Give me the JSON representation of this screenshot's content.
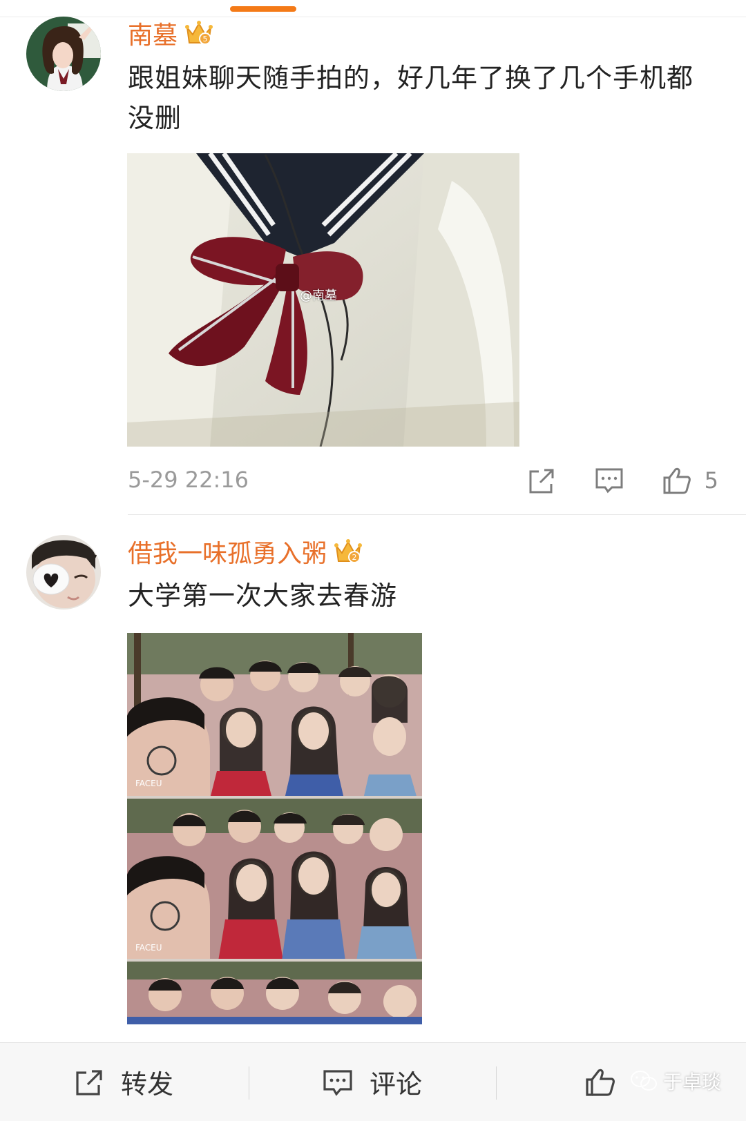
{
  "comments": [
    {
      "username": "南墓",
      "text": "跟姐妹聊天随手拍的，好几年了换了几个手机都没删",
      "photo_watermark": "@南墓",
      "timestamp": "5-29 22:16",
      "like_count": "5"
    },
    {
      "username": "借我一味孤勇入粥",
      "text": "大学第一次大家去春游",
      "photo_label_1": "FACEU",
      "photo_label_2": "FACEU"
    }
  ],
  "bottom_bar": {
    "repost_label": "转发",
    "comment_label": "评论"
  },
  "watermark": {
    "text": "于卓琰"
  },
  "colors": {
    "accent": "#f47a17",
    "username": "#e8702a",
    "timestamp": "#9a9a9a"
  }
}
